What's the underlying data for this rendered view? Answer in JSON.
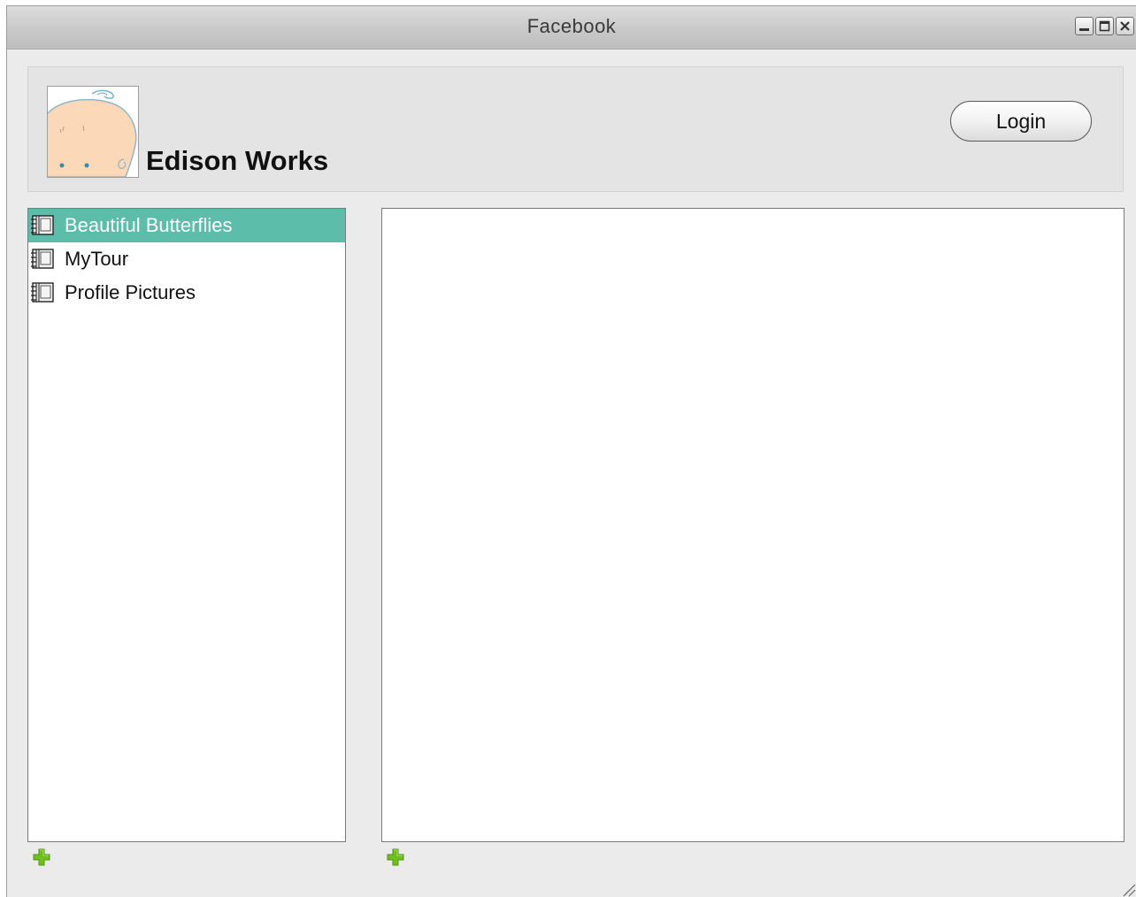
{
  "window": {
    "title": "Facebook",
    "controls": [
      "minimize-icon",
      "maximize-icon",
      "close-icon"
    ]
  },
  "header": {
    "profile_name": "Edison Works",
    "login_label": "Login"
  },
  "albums": {
    "items": [
      {
        "label": "Beautiful Butterflies",
        "selected": true
      },
      {
        "label": "MyTour",
        "selected": false
      },
      {
        "label": "Profile Pictures",
        "selected": false
      }
    ],
    "add_icon": "plus-icon"
  },
  "photos": {
    "add_icon": "plus-icon"
  },
  "colors": {
    "selection": "#5cbdaa",
    "add_icon": "#6fbf1f",
    "window_bg": "#ebebeb"
  }
}
